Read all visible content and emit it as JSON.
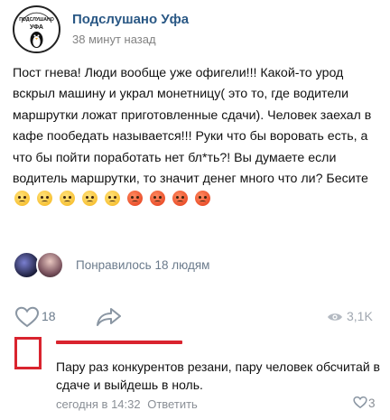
{
  "group": {
    "avatar_text": "ПОДСЛУШАНО УФА",
    "name": "Подслушано Уфа",
    "time": "38 минут назад"
  },
  "post": {
    "text": "Пост гнева! Люди вообще уже офигели!!! Какой-то урод вскрыл машину и украл монетницу( это то, где водители маршрутки ложат приготовленные сдачи). Человек заехал в кафе пообедать называется!!! Руки что бы воровать есть, а что бы пойти поработать нет бл*ть?! Вы думаете если водитель маршрутки, то значит денег много что ли? Бесите",
    "emojis": [
      "angry-face",
      "angry-face",
      "angry-face",
      "angry-face",
      "angry-face",
      "pouting-face",
      "pouting-face",
      "pouting-face",
      "pouting-face"
    ]
  },
  "likes": {
    "text": "Понравилось 18 людям"
  },
  "actions": {
    "like_count": "18",
    "views": "3,1K",
    "icons": {
      "like": "heart-icon",
      "share": "share-icon",
      "views": "eye-icon"
    }
  },
  "comment": {
    "text": "Пару раз конкурентов резани, пару человек обсчитай в сдаче и выйдешь в ноль.",
    "date": "сегодня в 14:32",
    "reply_label": "Ответить",
    "like_count": "3"
  },
  "colors": {
    "link_blue": "#2a5885",
    "muted_gray": "#828282",
    "redaction_red": "#d9242e"
  }
}
